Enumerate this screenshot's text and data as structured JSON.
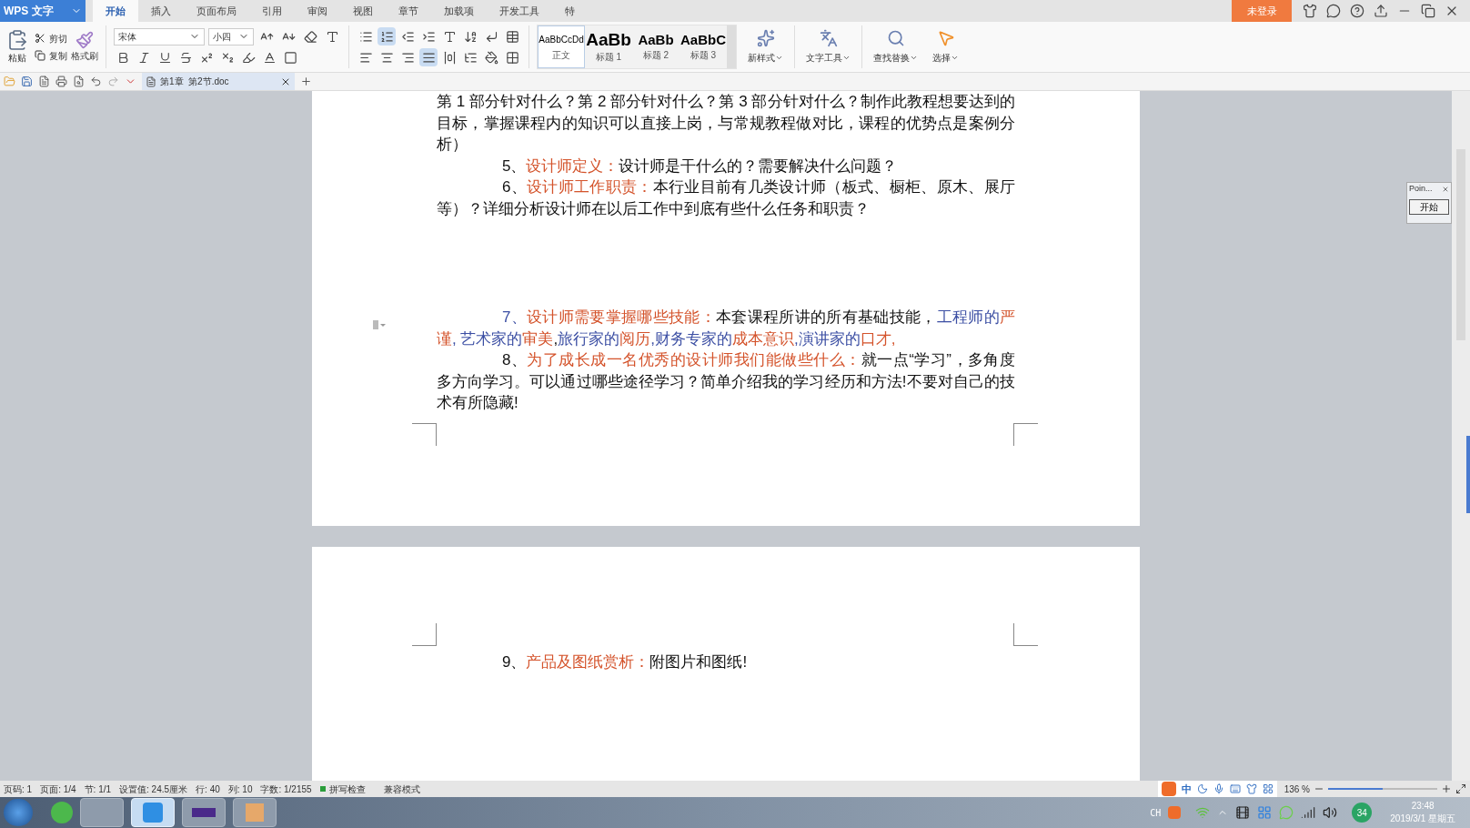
{
  "app_button": {
    "label": "WPS 文字"
  },
  "tabs": [
    {
      "label": "开始",
      "selected": true
    },
    {
      "label": "插入",
      "selected": false
    },
    {
      "label": "页面布局",
      "selected": false
    },
    {
      "label": "引用",
      "selected": false
    },
    {
      "label": "审阅",
      "selected": false
    },
    {
      "label": "视图",
      "selected": false
    },
    {
      "label": "章节",
      "selected": false
    },
    {
      "label": "加载项",
      "selected": false
    },
    {
      "label": "开发工具",
      "selected": false
    },
    {
      "label": "特",
      "selected": false
    }
  ],
  "login_button": "未登录",
  "clipboard": {
    "paste": "粘贴",
    "cut": "剪切",
    "copy": "复制",
    "format_painter": "格式刷"
  },
  "font": {
    "name": "宋体",
    "size": "小四"
  },
  "list_buttons": [
    {
      "selected": false
    },
    {
      "selected": true
    }
  ],
  "alignment": [
    {
      "selected": false
    },
    {
      "selected": false
    },
    {
      "selected": false
    },
    {
      "selected": true
    },
    {
      "selected": false
    }
  ],
  "styles": [
    {
      "sample": "AaBbCcDd",
      "label": "正文",
      "selected": true
    },
    {
      "sample": "AaBb",
      "label": "标题 1",
      "selected": false
    },
    {
      "sample": "AaBb",
      "label": "标题 2",
      "selected": false
    },
    {
      "sample": "AaBbC",
      "label": "标题 3",
      "selected": false
    }
  ],
  "ribbon_tools": [
    "新样式",
    "文字工具",
    "查找替换",
    "选择"
  ],
  "document_tab": {
    "title": "第1章  第2节.doc"
  },
  "pages": [
    {
      "blocks": [
        [
          {
            "kind": "continuation",
            "segments": [
              {
                "kind": "plain",
                "text": "第 1 部分针对什么？第 2 部分针对什么？第 3 部分针对什么？制作此教程想要达到的目标，掌握课程内的知识可以直接上岗，与常规教程做对比，课程的优势点是案例分析）"
              }
            ]
          },
          {
            "kind": "item",
            "segments": [
              {
                "kind": "plain",
                "text": "5、"
              },
              {
                "kind": "heading",
                "text": "设计师定义："
              },
              {
                "kind": "plain",
                "text": "设计师是干什么的？需要解决什么问题？"
              }
            ]
          },
          {
            "kind": "item",
            "segments": [
              {
                "kind": "plain",
                "text": "6、"
              },
              {
                "kind": "heading",
                "text": "设计师工作职责："
              },
              {
                "kind": "plain",
                "text": "本行业目前有几类设计师（板式、橱柜、原木、展厅等）？详细分析设计师在以后工作中到底有些什么任务和职责？"
              }
            ]
          }
        ],
        [
          {
            "kind": "item",
            "segments": [
              {
                "kind": "person",
                "text": "7、"
              },
              {
                "kind": "heading",
                "text": "设计师需要掌握哪些技能："
              },
              {
                "kind": "plain",
                "text": "本套课程所讲的所有基础技能，"
              },
              {
                "kind": "person",
                "text": "工程师的"
              },
              {
                "kind": "quality",
                "text": "严谨"
              },
              {
                "kind": "person",
                "text": ", 艺术家的"
              },
              {
                "kind": "quality",
                "text": "审美"
              },
              {
                "kind": "plain",
                "text": ","
              },
              {
                "kind": "person",
                "text": "旅行家的"
              },
              {
                "kind": "quality",
                "text": "阅历"
              },
              {
                "kind": "person",
                "text": ",财务专家的"
              },
              {
                "kind": "quality",
                "text": "成本意识"
              },
              {
                "kind": "person",
                "text": ",演讲家的"
              },
              {
                "kind": "quality",
                "text": "口才,"
              }
            ]
          },
          {
            "kind": "item",
            "segments": [
              {
                "kind": "plain",
                "text": "8、"
              },
              {
                "kind": "heading",
                "text": "为了成长成一名优秀的设计师我们能做些什么："
              },
              {
                "kind": "plain",
                "text": "就一点“学习”，多角度多方向学习。可以通过哪些途径学习？简单介绍我的学习经历和方法!不要对自己的技术有所隐藏!"
              }
            ]
          }
        ]
      ]
    },
    {
      "blocks": [
        [
          {
            "kind": "item",
            "segments": [
              {
                "kind": "plain",
                "text": "9、"
              },
              {
                "kind": "heading",
                "text": "产品及图纸赏析："
              },
              {
                "kind": "plain",
                "text": "附图片和图纸!"
              }
            ]
          }
        ]
      ]
    }
  ],
  "side_panel": {
    "title": "Poin...",
    "button": "开始"
  },
  "status_bar": {
    "items": [
      "页码: 1",
      "页面: 1/4",
      "节: 1/1",
      "设置值: 24.5厘米",
      "行: 40",
      "列: 10",
      "字数: 1/2155"
    ],
    "spell_check": "拼写检查",
    "mode": "兼容模式"
  },
  "ime_toolbar": {
    "mode": "中"
  },
  "zoom": {
    "reading": "136 %",
    "level": 0.5
  },
  "taskbar": {
    "language": "CH",
    "badge": "34",
    "time": "23:48",
    "date": "2019/3/1 星期五"
  }
}
